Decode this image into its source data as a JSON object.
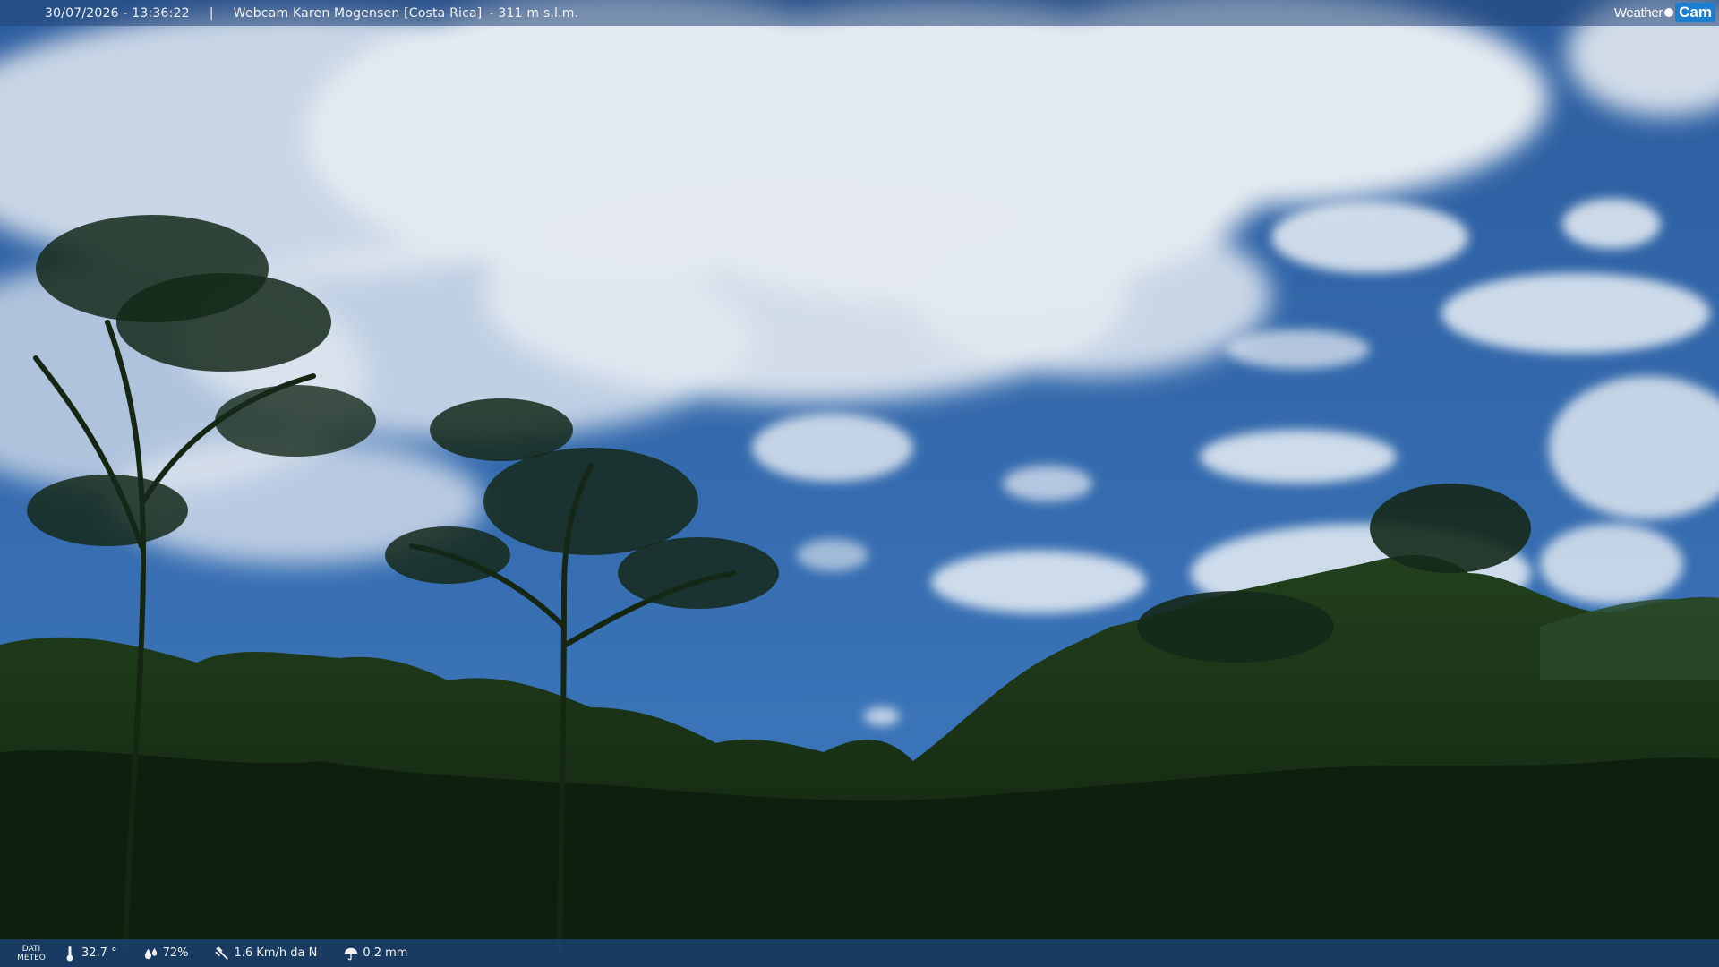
{
  "overlay": {
    "timestamp": "30/07/2026 - 13:36:22",
    "separator": "|",
    "title": "Webcam Karen Mogensen [Costa Rica]",
    "altitude": "- 311 m s.l.m."
  },
  "logo": {
    "weather": "Weather",
    "cam": "Cam"
  },
  "weather_bar": {
    "label_line1": "DATI",
    "label_line2": "METEO",
    "items": [
      {
        "icon": "thermometer-icon",
        "value": "32.7 °"
      },
      {
        "icon": "humidity-drops-icon",
        "value": "72%"
      },
      {
        "icon": "wind-icon",
        "value": "1.6 Km/h da N"
      },
      {
        "icon": "rain-umbrella-icon",
        "value": "0.2 mm"
      }
    ]
  },
  "colors": {
    "sky_top": "#2b5c9e",
    "sky_bottom": "#3c78bc",
    "cloud": "#e6ecf2",
    "forest_dark": "#10220f",
    "forest_mid": "#1f3a1b",
    "bar": "#1e467d"
  }
}
